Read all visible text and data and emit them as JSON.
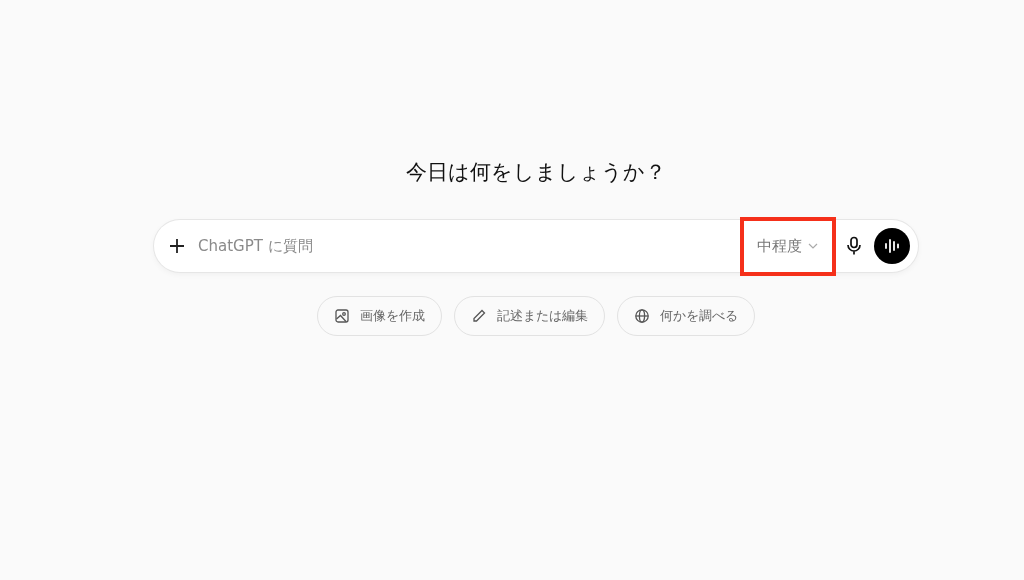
{
  "heading": "今日は何をしましょうか？",
  "composer": {
    "placeholder": "ChatGPT に質問",
    "model_selector": {
      "label": "中程度",
      "highlighted": true
    }
  },
  "suggestions": [
    {
      "kind": "image",
      "label": "画像を作成"
    },
    {
      "kind": "pencil",
      "label": "記述または編集"
    },
    {
      "kind": "globe",
      "label": "何かを調べる"
    }
  ]
}
